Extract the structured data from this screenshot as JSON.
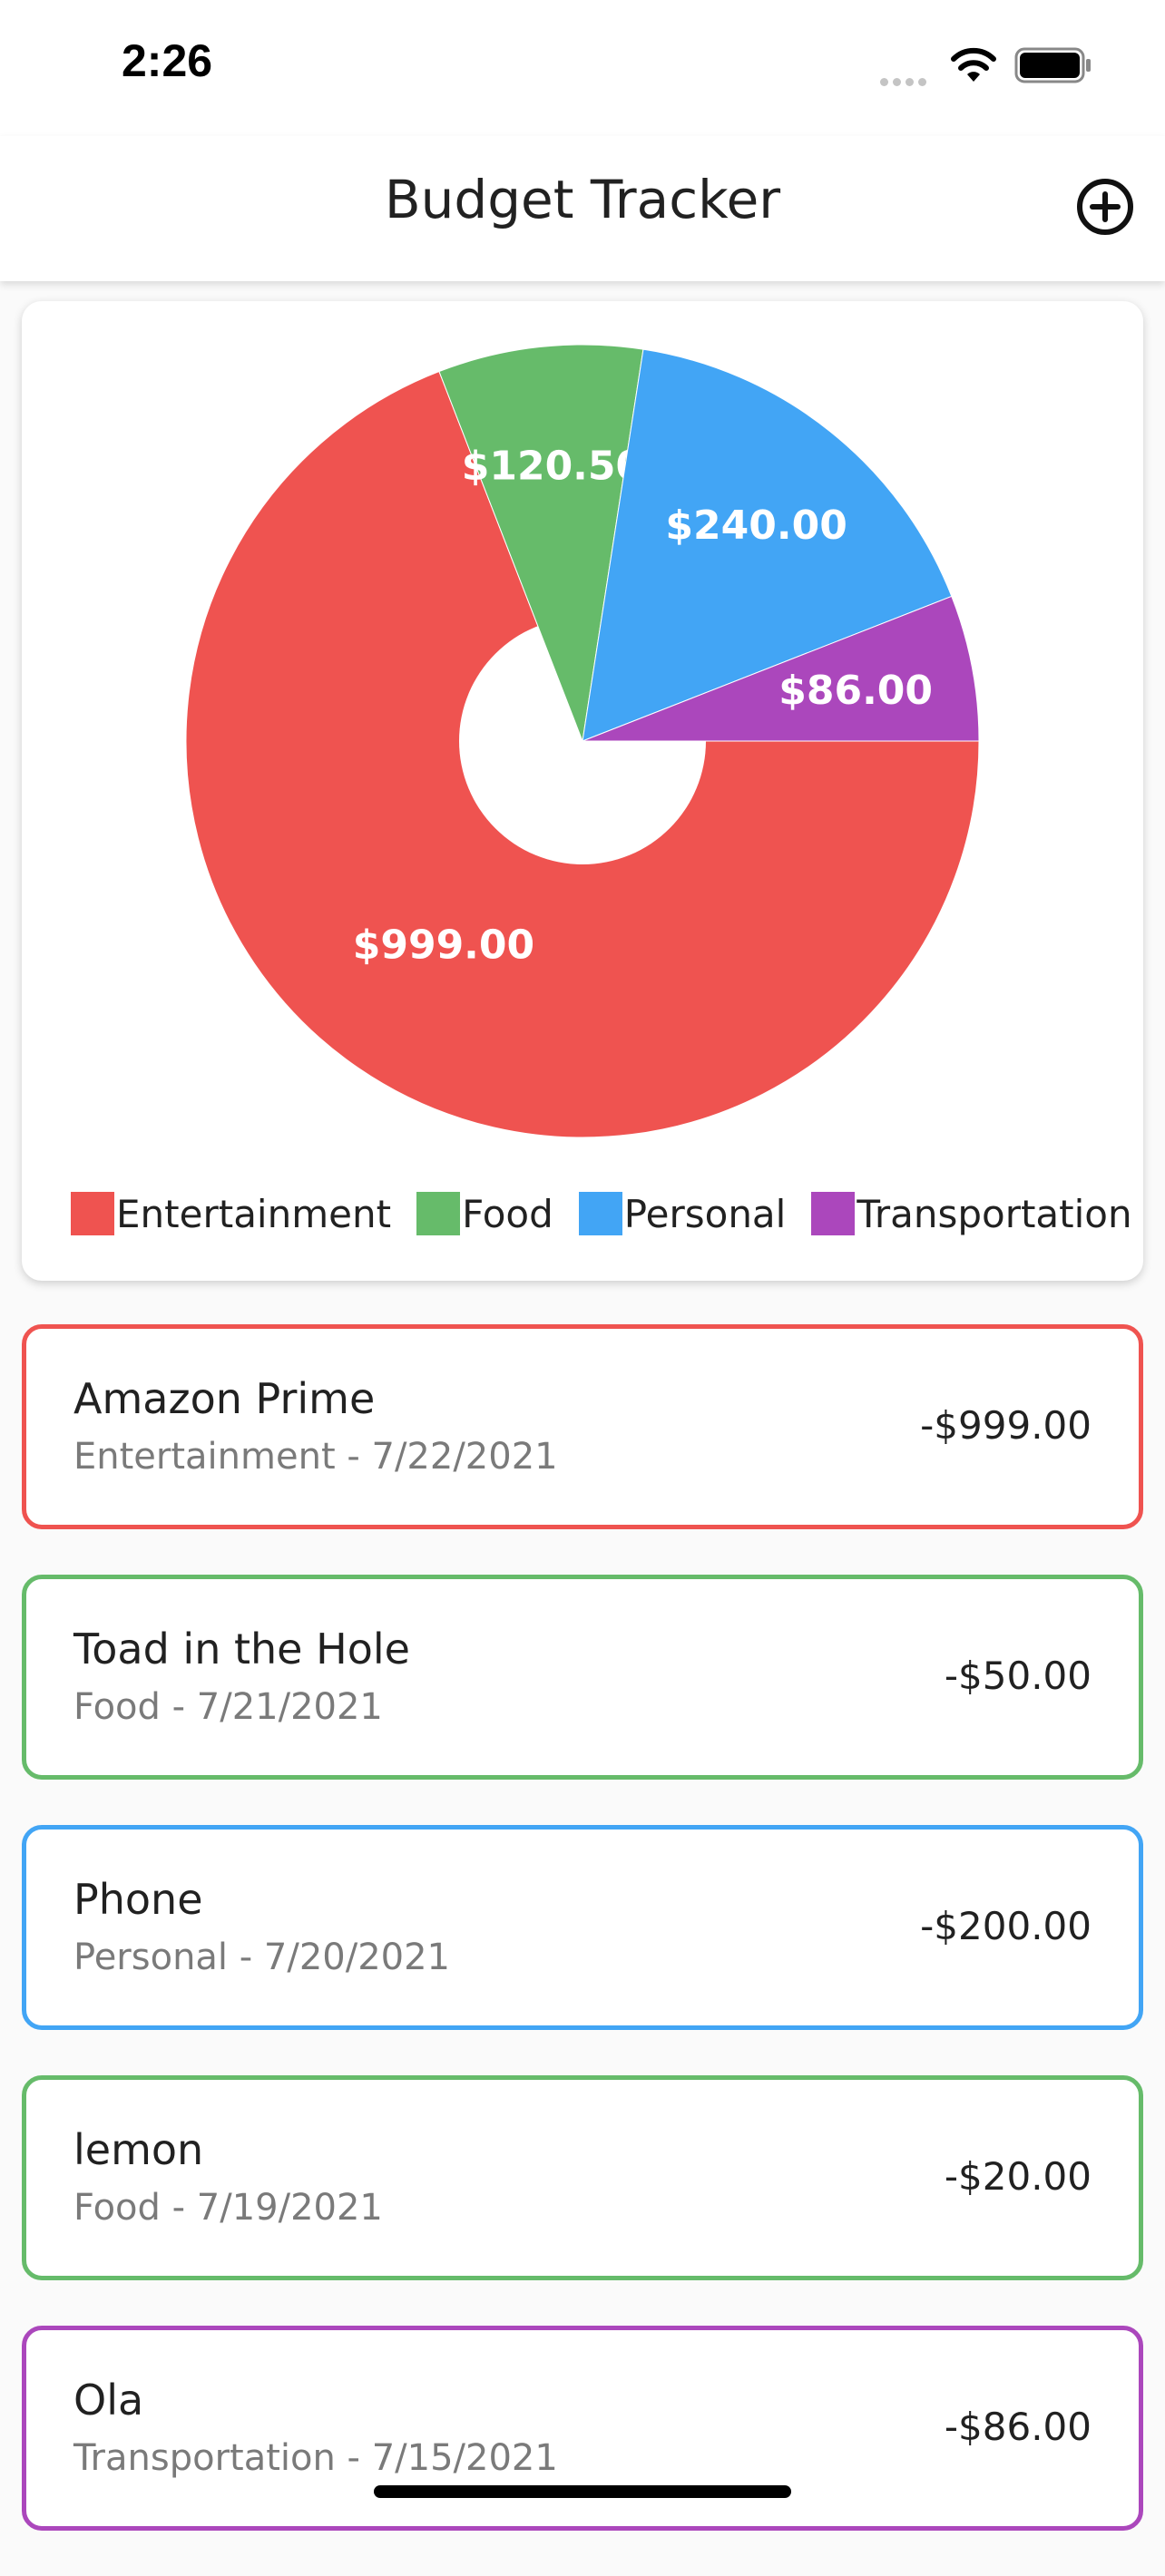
{
  "status_bar": {
    "time": "2:26"
  },
  "app_bar": {
    "title": "Budget Tracker",
    "add_icon": "plus-circle-icon"
  },
  "chart_data": {
    "type": "pie",
    "categories": [
      "Entertainment",
      "Food",
      "Personal",
      "Transportation"
    ],
    "values": [
      999.0,
      120.5,
      240.0,
      86.0
    ],
    "labels": [
      "$999.00",
      "$120.50",
      "$240.00",
      "$86.00"
    ],
    "colors": [
      "#ef5350",
      "#66bb6a",
      "#42a5f5",
      "#ab47bc"
    ],
    "donut": true,
    "legend_position": "bottom"
  },
  "transactions": [
    {
      "name": "Amazon Prime",
      "subtitle": "Entertainment - 7/22/2021",
      "amount": "-$999.00",
      "color": "#ef5350"
    },
    {
      "name": "Toad in the Hole",
      "subtitle": "Food - 7/21/2021",
      "amount": "-$50.00",
      "color": "#66bb6a"
    },
    {
      "name": "Phone",
      "subtitle": "Personal - 7/20/2021",
      "amount": "-$200.00",
      "color": "#42a5f5"
    },
    {
      "name": "lemon",
      "subtitle": "Food - 7/19/2021",
      "amount": "-$20.00",
      "color": "#66bb6a"
    },
    {
      "name": "Ola",
      "subtitle": "Transportation - 7/15/2021",
      "amount": "-$86.00",
      "color": "#ab47bc"
    }
  ]
}
